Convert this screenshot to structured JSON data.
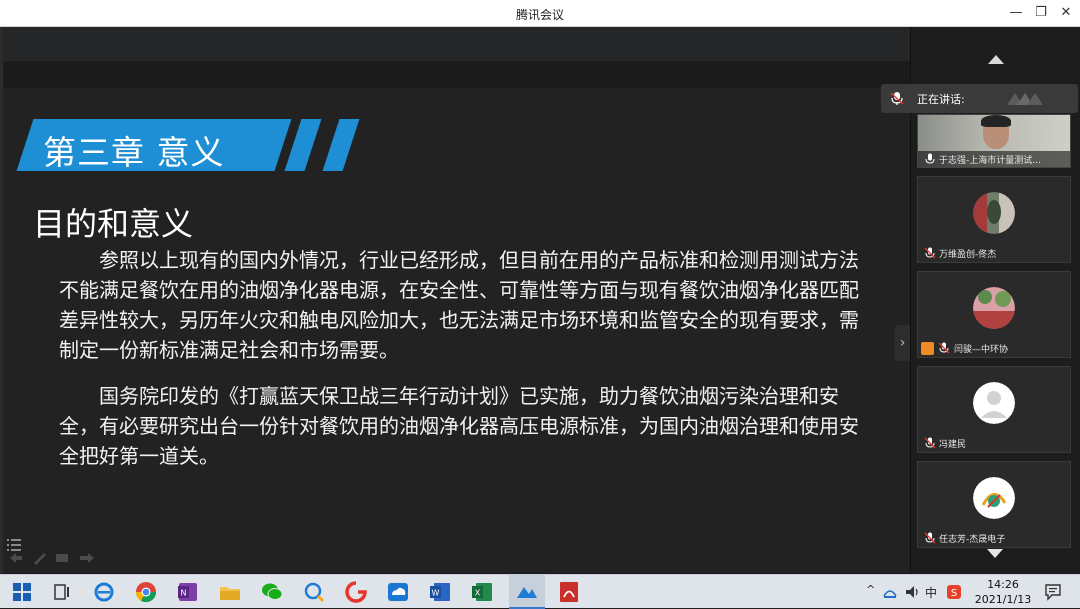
{
  "window": {
    "title": "腾讯会议",
    "minimize": "—",
    "maximize": "❐",
    "close": "✕"
  },
  "slide": {
    "chapter": "第三章 意义",
    "heading": "目的和意义",
    "paragraph1": "参照以上现有的国内外情况，行业已经形成，但目前在用的产品标准和检测用测试方法不能满足餐饮在用的油烟净化器电源，在安全性、可靠性等方面与现有餐饮油烟净化器匹配差异性较大，另历年火灾和触电风险加大，也无法满足市场环境和监管安全的现有要求，需制定一份新标准满足社会和市场需要。",
    "paragraph2": "国务院印发的《打赢蓝天保卫战三年行动计划》已实施，助力餐饮油烟污染治理和安全，有必要研究出台一份针对餐饮用的油烟净化器高压电源标准，为国内油烟治理和使用安全把好第一道关。"
  },
  "panel": {
    "speaking_label": "正在讲话:",
    "participants": [
      {
        "name": "于志强-上海市计量测试...",
        "type": "video"
      },
      {
        "name": "万维盈创-佟杰",
        "type": "avatar"
      },
      {
        "name": "闫骏—中环协",
        "type": "avatar",
        "host": true
      },
      {
        "name": "冯建民",
        "type": "avatar"
      },
      {
        "name": "任志芳-杰晟电子",
        "type": "avatar"
      }
    ]
  },
  "taskbar": {
    "ime": "中",
    "time": "14:26",
    "date": "2021/1/13"
  },
  "colors": {
    "banner": "#1e8fd4",
    "slide_bg": "#222222",
    "host_badge": "#f08a24"
  }
}
